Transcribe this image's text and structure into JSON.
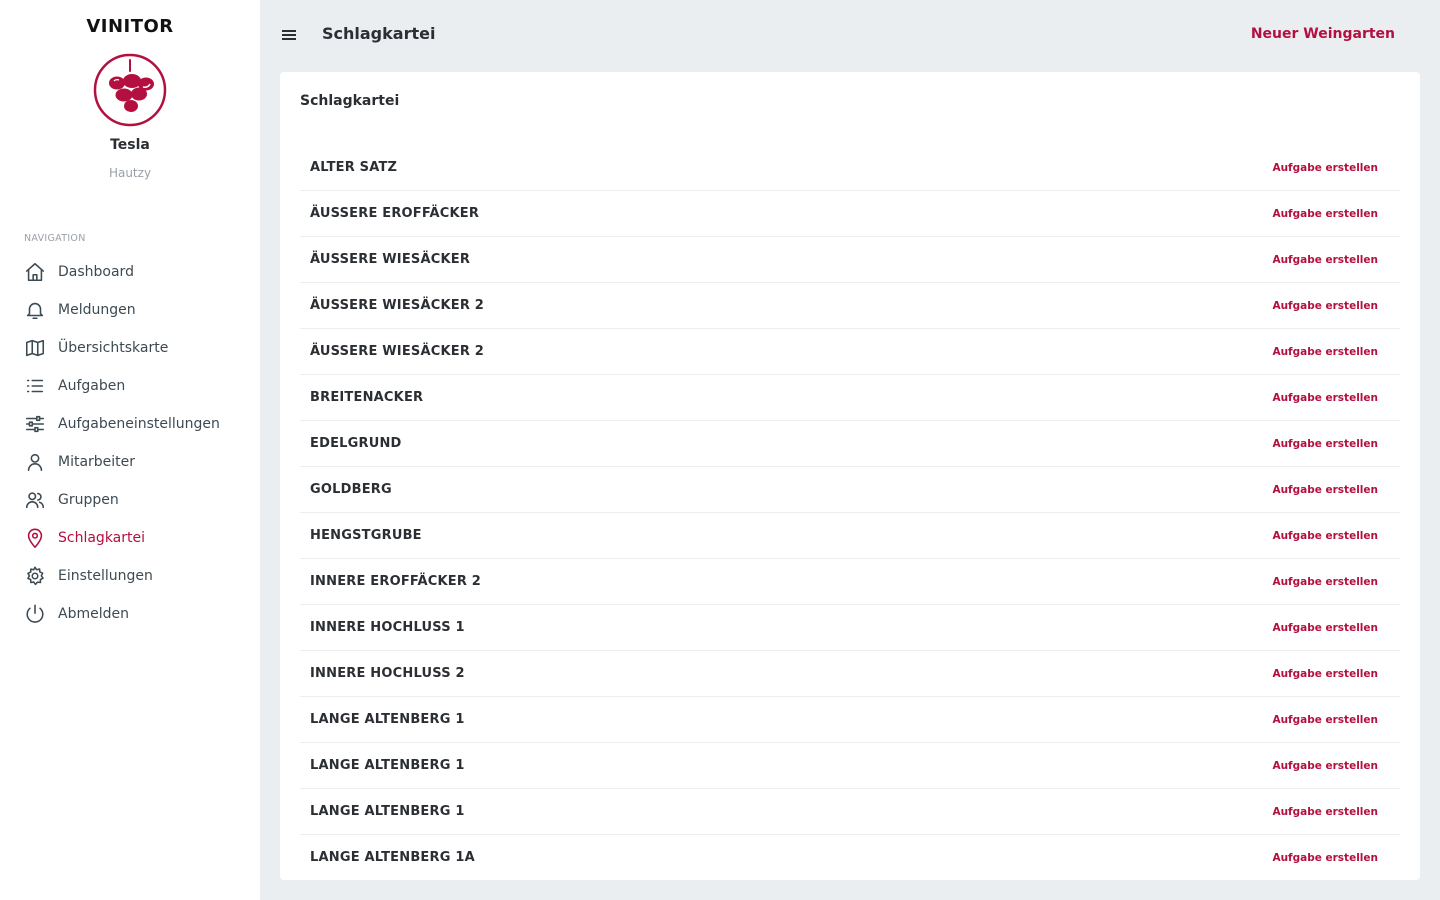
{
  "brand": "VINITOR",
  "user": {
    "name": "Tesla",
    "org": "Hautzy"
  },
  "nav_heading": "NAVIGATION",
  "nav": [
    {
      "label": "Dashboard",
      "icon": "home-icon",
      "active": false
    },
    {
      "label": "Meldungen",
      "icon": "bell-icon",
      "active": false
    },
    {
      "label": "Übersichtskarte",
      "icon": "map-icon",
      "active": false
    },
    {
      "label": "Aufgaben",
      "icon": "list-icon",
      "active": false
    },
    {
      "label": "Aufgabeneinstellungen",
      "icon": "sliders-icon",
      "active": false
    },
    {
      "label": "Mitarbeiter",
      "icon": "user-icon",
      "active": false
    },
    {
      "label": "Gruppen",
      "icon": "users-icon",
      "active": false
    },
    {
      "label": "Schlagkartei",
      "icon": "map-pin-icon",
      "active": true
    },
    {
      "label": "Einstellungen",
      "icon": "gear-icon",
      "active": false
    },
    {
      "label": "Abmelden",
      "icon": "power-icon",
      "active": false
    }
  ],
  "topbar": {
    "title": "Schlagkartei",
    "new_button": "Neuer Weingarten"
  },
  "card": {
    "title": "Schlagkartei"
  },
  "action_label": "Aufgabe erstellen",
  "rows": [
    "ALTER SATZ",
    "ÄUSSERE EROFFÄCKER",
    "ÄUSSERE WIESÄCKER",
    "ÄUSSERE WIESÄCKER 2",
    "ÄUSSERE WIESÄCKER 2",
    "BREITENACKER",
    "EDELGRUND",
    "GOLDBERG",
    "HENGSTGRUBE",
    "INNERE EROFFÄCKER 2",
    "INNERE HOCHLUSS 1",
    "INNERE HOCHLUSS 2",
    "LANGE ALTENBERG 1",
    "LANGE ALTENBERG 1",
    "LANGE ALTENBERG 1",
    "LANGE ALTENBERG 1A"
  ],
  "colors": {
    "accent": "#b3103f",
    "background": "#ebeef1"
  }
}
